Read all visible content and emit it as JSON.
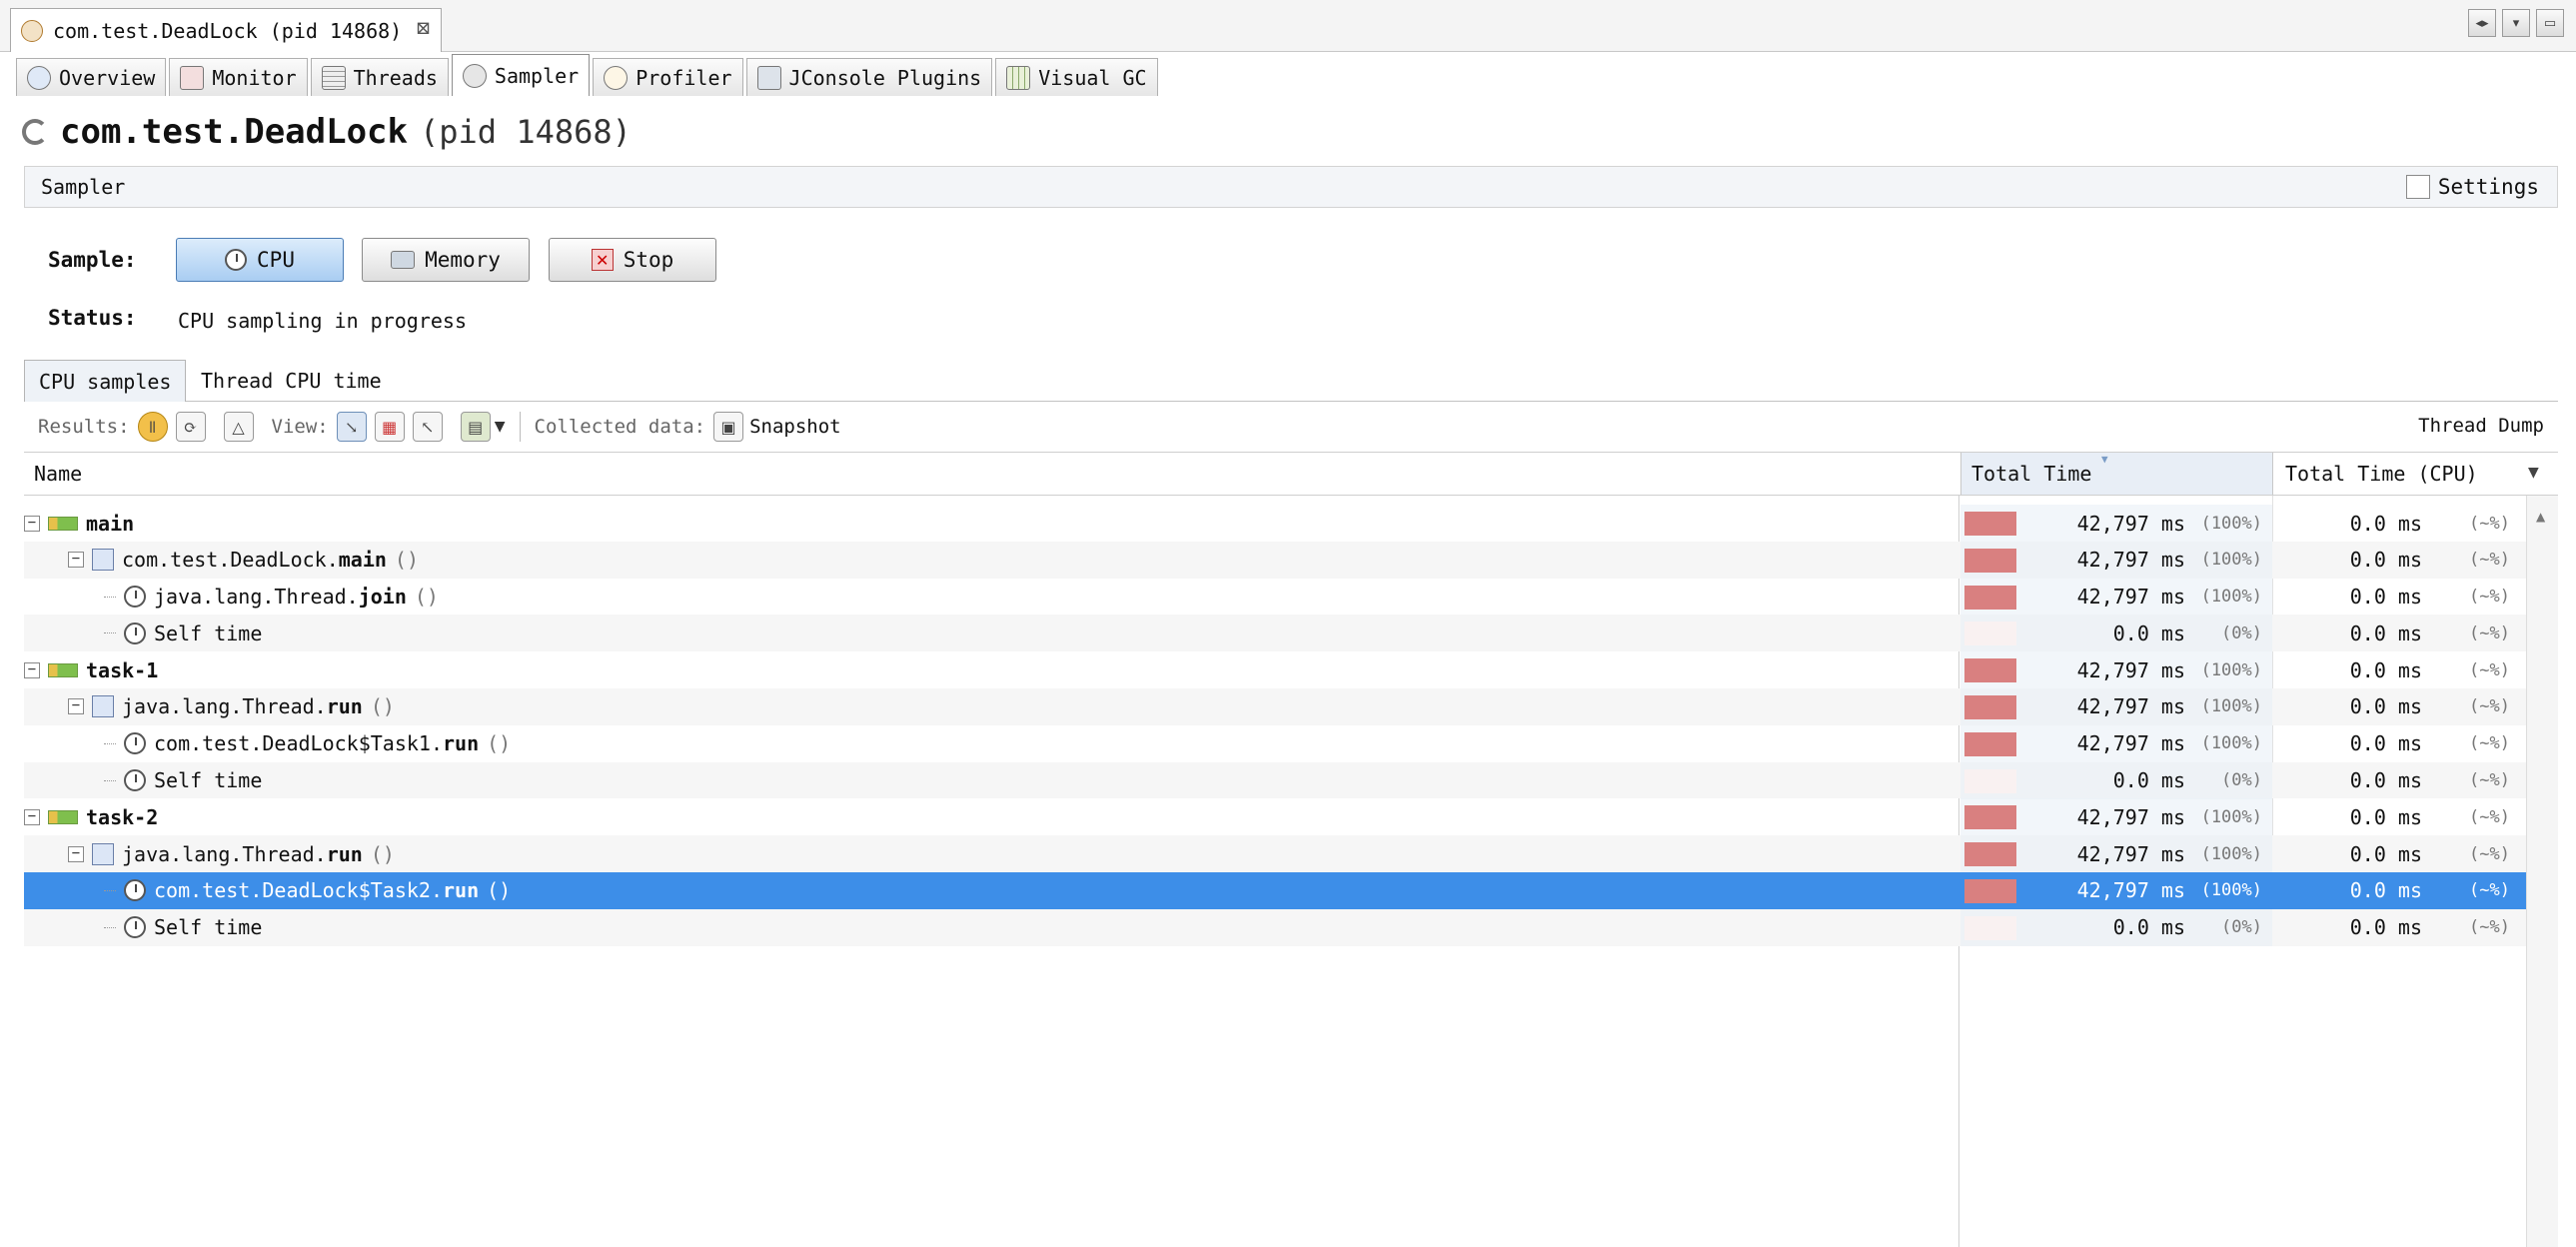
{
  "document_tab": {
    "title": "com.test.DeadLock (pid 14868)",
    "close_symbol": "⊠"
  },
  "window_controls": [
    "◂▸",
    "▾",
    "▭"
  ],
  "view_tabs": [
    {
      "label": "Overview",
      "icon": "info-icon"
    },
    {
      "label": "Monitor",
      "icon": "monitor-icon"
    },
    {
      "label": "Threads",
      "icon": "threads-icon"
    },
    {
      "label": "Sampler",
      "icon": "sampler-icon",
      "active": true
    },
    {
      "label": "Profiler",
      "icon": "profiler-icon"
    },
    {
      "label": "JConsole Plugins",
      "icon": "plugin-icon"
    },
    {
      "label": "Visual GC",
      "icon": "gc-icon"
    }
  ],
  "header": {
    "app_name": "com.test.DeadLock",
    "pid": "(pid 14868)"
  },
  "sampler_section": {
    "title": "Sampler",
    "settings_label": "Settings"
  },
  "sample": {
    "label": "Sample:",
    "buttons": {
      "cpu": "CPU",
      "memory": "Memory",
      "stop": "Stop"
    },
    "status_label": "Status:",
    "status_value": "CPU sampling in progress"
  },
  "subtabs": {
    "cpu_samples": "CPU samples",
    "thread_cpu_time": "Thread CPU time"
  },
  "toolbar": {
    "results_label": "Results:",
    "view_label": "View:",
    "collected_label": "Collected data:",
    "snapshot_label": "Snapshot",
    "thread_dump": "Thread Dump"
  },
  "table": {
    "columns": {
      "name": "Name",
      "total_time": "Total Time",
      "total_time_cpu": "Total Time (CPU)"
    },
    "rows": [
      {
        "name": "main",
        "bold": "",
        "args": "",
        "kind": "thread",
        "total": "42,797 ms",
        "pct": "(100%)",
        "fill": 1.0,
        "cpu": "0.0 ms",
        "cpu_pct": "(~%)"
      },
      {
        "name": "com.test.DeadLock.",
        "bold": "main",
        "args": "()",
        "kind": "method",
        "total": "42,797 ms",
        "pct": "(100%)",
        "fill": 1.0,
        "cpu": "0.0 ms",
        "cpu_pct": "(~%)"
      },
      {
        "name": "java.lang.Thread.",
        "bold": "join",
        "args": "()",
        "kind": "clock",
        "total": "42,797 ms",
        "pct": "(100%)",
        "fill": 1.0,
        "cpu": "0.0 ms",
        "cpu_pct": "(~%)"
      },
      {
        "name": "Self time",
        "bold": "",
        "args": "",
        "kind": "clock",
        "total": "0.0 ms",
        "pct": "(0%)",
        "fill": 0.0,
        "cpu": "0.0 ms",
        "cpu_pct": "(~%)"
      },
      {
        "name": "task-1",
        "bold": "",
        "args": "",
        "kind": "thread",
        "total": "42,797 ms",
        "pct": "(100%)",
        "fill": 1.0,
        "cpu": "0.0 ms",
        "cpu_pct": "(~%)"
      },
      {
        "name": "java.lang.Thread.",
        "bold": "run",
        "args": "()",
        "kind": "method",
        "total": "42,797 ms",
        "pct": "(100%)",
        "fill": 1.0,
        "cpu": "0.0 ms",
        "cpu_pct": "(~%)"
      },
      {
        "name": "com.test.DeadLock$Task1.",
        "bold": "run",
        "args": "()",
        "kind": "clock",
        "total": "42,797 ms",
        "pct": "(100%)",
        "fill": 1.0,
        "cpu": "0.0 ms",
        "cpu_pct": "(~%)"
      },
      {
        "name": "Self time",
        "bold": "",
        "args": "",
        "kind": "clock",
        "total": "0.0 ms",
        "pct": "(0%)",
        "fill": 0.0,
        "cpu": "0.0 ms",
        "cpu_pct": "(~%)"
      },
      {
        "name": "task-2",
        "bold": "",
        "args": "",
        "kind": "thread",
        "total": "42,797 ms",
        "pct": "(100%)",
        "fill": 1.0,
        "cpu": "0.0 ms",
        "cpu_pct": "(~%)"
      },
      {
        "name": "java.lang.Thread.",
        "bold": "run",
        "args": "()",
        "kind": "method",
        "total": "42,797 ms",
        "pct": "(100%)",
        "fill": 1.0,
        "cpu": "0.0 ms",
        "cpu_pct": "(~%)"
      },
      {
        "name": "com.test.DeadLock$Task2.",
        "bold": "run",
        "args": "()",
        "kind": "clock",
        "total": "42,797 ms",
        "pct": "(100%)",
        "fill": 1.0,
        "cpu": "0.0 ms",
        "cpu_pct": "(~%)",
        "selected": true
      },
      {
        "name": "Self time",
        "bold": "",
        "args": "",
        "kind": "clock",
        "total": "0.0 ms",
        "pct": "(0%)",
        "fill": 0.0,
        "cpu": "0.0 ms",
        "cpu_pct": "(~%)"
      }
    ]
  },
  "colors": {
    "selection": "#3d8ee8",
    "bar_fill": "#d98080",
    "cpu_button": "#a9cdf2"
  }
}
